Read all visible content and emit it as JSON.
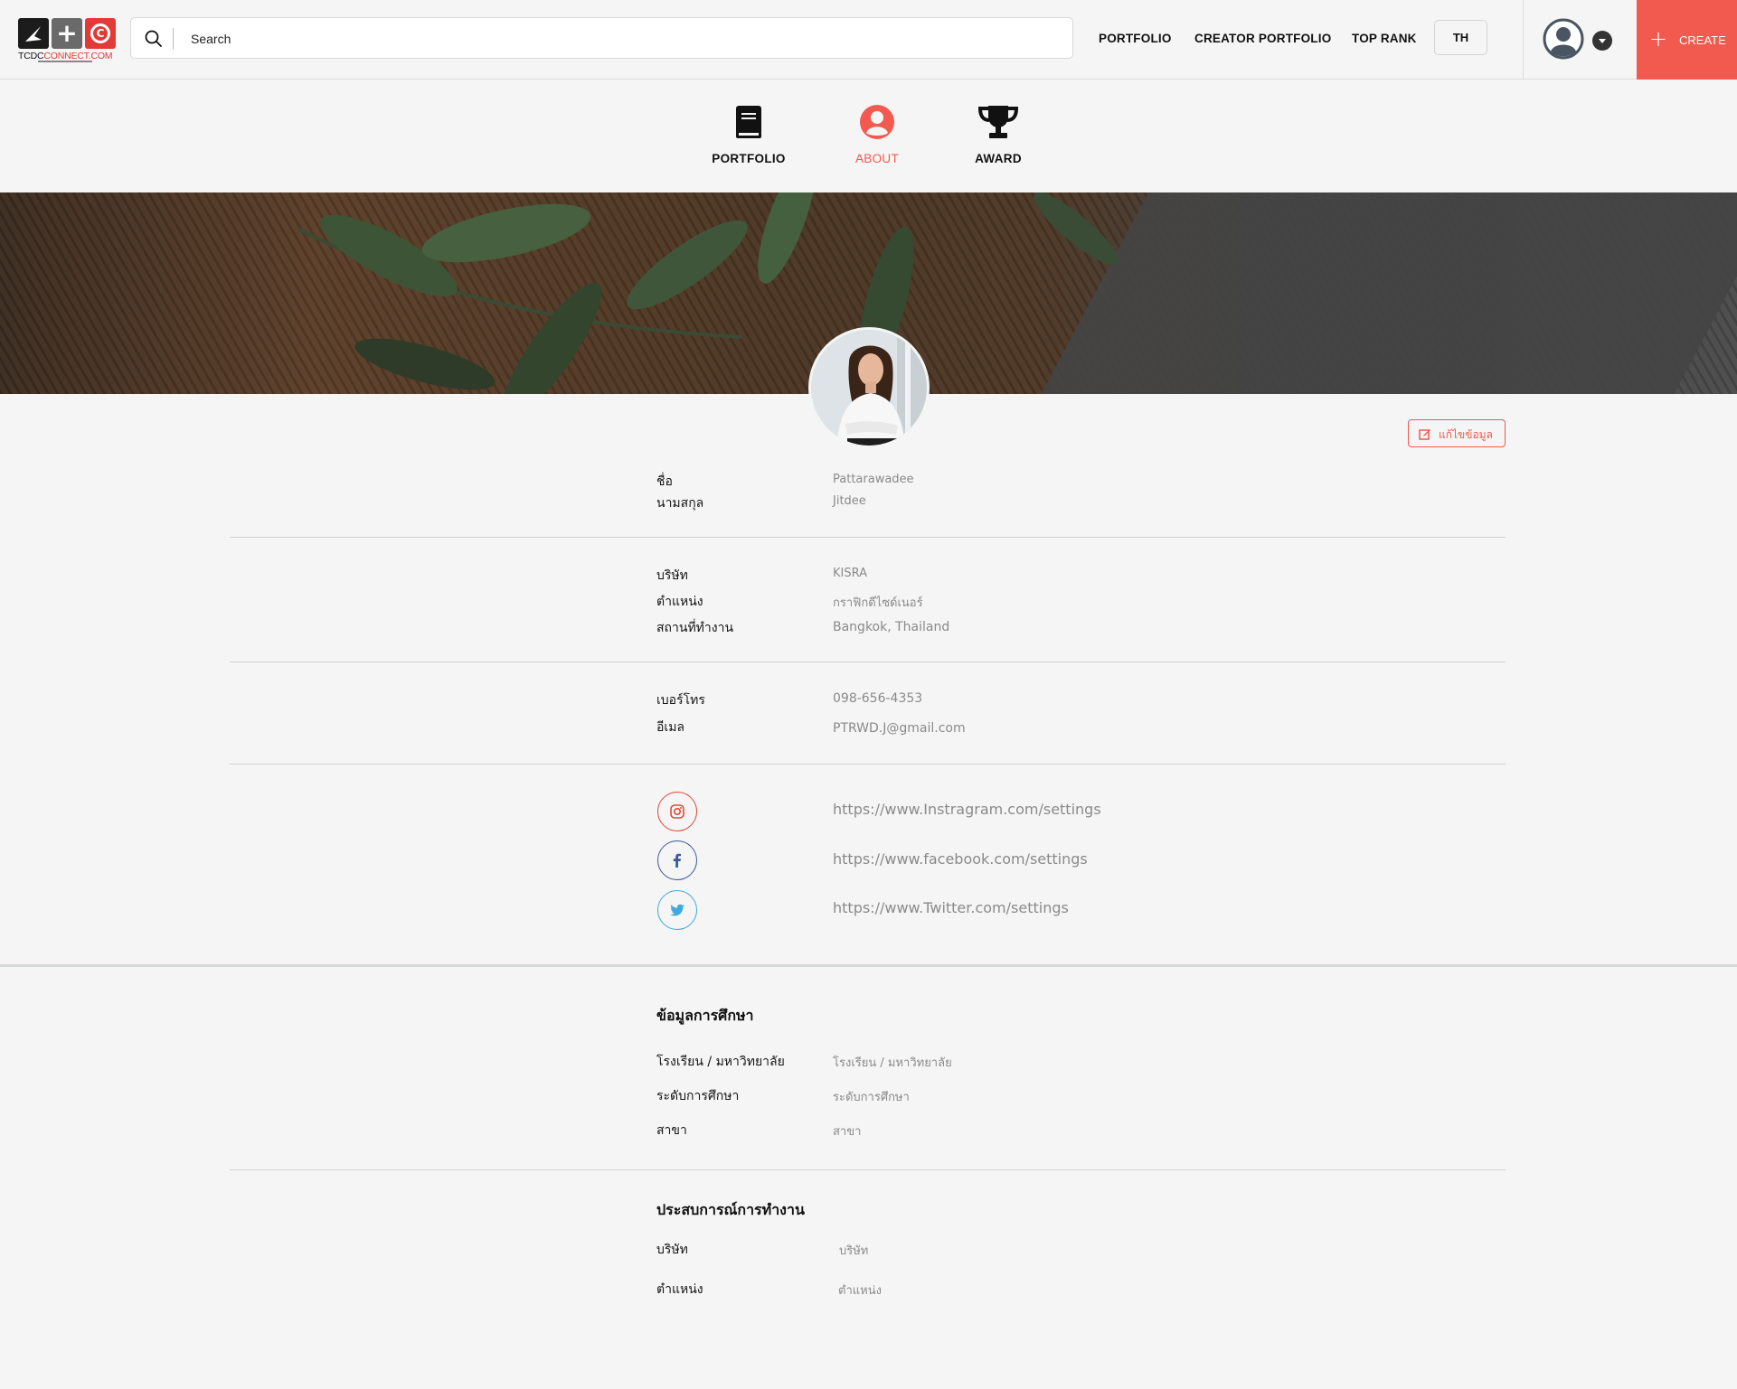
{
  "header": {
    "logo_text_dark": "TCDC",
    "logo_text_red": "CONNECT.COM",
    "search_placeholder": "Search",
    "nav": [
      "PORTFOLIO",
      "CREATOR  PORTFOLIO",
      "TOP RANK"
    ],
    "lang": "TH",
    "create": "CREATE",
    "accent": "#f25a4f"
  },
  "tabs": [
    {
      "label": "PORTFOLIO",
      "icon": "book-icon"
    },
    {
      "label": "ABOUT",
      "icon": "user-circle-icon",
      "active": true
    },
    {
      "label": "AWARD",
      "icon": "trophy-icon"
    }
  ],
  "profile": {
    "edit_label": "แก้ไขข้อมูล",
    "name": {
      "label": "ชื่อ",
      "value": "Pattarawadee"
    },
    "surname": {
      "label": "นามสกุล",
      "value": "Jitdee"
    },
    "company": {
      "label": "บริษัท",
      "value": "KISRA"
    },
    "position": {
      "label": "ตำแหน่ง",
      "value": "กราฟิกดีไซด์เนอร์"
    },
    "workplace": {
      "label": "สถานที่ทำงาน",
      "value": "Bangkok, Thailand"
    },
    "phone": {
      "label": "เบอร์โทร",
      "value": "098-656-4353"
    },
    "email": {
      "label": "อีเมล",
      "value": "PTRWD.J@gmail.com"
    }
  },
  "social": {
    "instagram": "https://www.Instragram.com/settings",
    "facebook": "https://www.facebook.com/settings",
    "twitter": "https://www.Twitter.com/settings"
  },
  "education": {
    "title": "ข้อมูลการศึกษา",
    "school": {
      "label": "โรงเรียน / มหาวิทยาลัย",
      "value": "โรงเรียน / มหาวิทยาลัย"
    },
    "level": {
      "label": "ระดับการศึกษา",
      "value": "ระดับการศึกษา"
    },
    "major": {
      "label": "สาขา",
      "value": "สาขา"
    }
  },
  "experience": {
    "title": "ประสบการณ์การทำงาน",
    "company": {
      "label": "บริษัท",
      "value": "บริษัท"
    },
    "position": {
      "label": "ตำแหน่ง",
      "value": "ตำแหน่ง"
    }
  }
}
